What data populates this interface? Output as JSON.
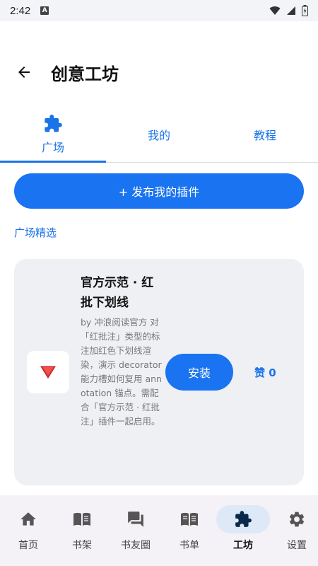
{
  "status_bar": {
    "time": "2:42",
    "notification_icon": "A"
  },
  "header": {
    "title": "创意工坊",
    "back_icon": "arrow-left-icon"
  },
  "tabs": [
    {
      "label": "广场",
      "icon": "puzzle-icon",
      "active": true
    },
    {
      "label": "我的",
      "active": false
    },
    {
      "label": "教程",
      "active": false
    }
  ],
  "publish_button": {
    "label": "+ 发布我的插件"
  },
  "section": {
    "title": "广场精选"
  },
  "plugin": {
    "name": "官方示范 · 红批下划线",
    "description": "by 冲浪阅读官方 对「红批注」类型的标注加红色下划线渲染，演示 decorator 能力槽如何复用 annotation 锚点。需配合「官方示范 · 红批注」插件一起启用。",
    "install_label": "安装",
    "like_label": "赞 0",
    "thumb_icon": "red-triangle-icon"
  },
  "bottom_nav": [
    {
      "label": "首页",
      "icon": "home-icon",
      "active": false
    },
    {
      "label": "书架",
      "icon": "book-open-icon",
      "active": false
    },
    {
      "label": "书友圈",
      "icon": "forum-icon",
      "active": false
    },
    {
      "label": "书单",
      "icon": "book-list-icon",
      "active": false
    },
    {
      "label": "工坊",
      "icon": "puzzle-icon",
      "active": true
    },
    {
      "label": "设置",
      "icon": "gear-icon",
      "active": false
    }
  ],
  "colors": {
    "accent": "#1a73e8",
    "button": "#1a73f0",
    "card": "#eef0f4",
    "nav_bg": "#f4f1f7"
  }
}
